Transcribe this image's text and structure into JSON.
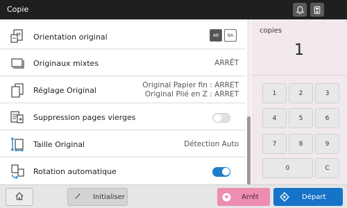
{
  "header": {
    "title": "Copie",
    "bell_icon": "bell-icon",
    "device_icon": "device-status-icon"
  },
  "settings": [
    {
      "label": "Orientation original",
      "icon": "orientation-icon",
      "options": [
        "AB",
        "BA"
      ],
      "selected": 0
    },
    {
      "label": "Originaux mixtes",
      "icon": "stacked-pages-icon",
      "value": "ARRÊT"
    },
    {
      "label": "Réglage Original",
      "icon": "pages-icon",
      "value_line1": "Original Papier fin : ARRET",
      "value_line2": "Original Plié en Z : ARRET"
    },
    {
      "label": "Suppression pages vierges",
      "icon": "skip-blank-pages-icon",
      "toggle": false
    },
    {
      "label": "Taille Original",
      "icon": "original-size-icon",
      "value": "Détection Auto"
    },
    {
      "label": "Rotation automatique",
      "icon": "auto-rotate-icon",
      "toggle": true
    }
  ],
  "keypad": {
    "label": "copies",
    "value": "1",
    "keys": [
      "1",
      "2",
      "3",
      "4",
      "5",
      "6",
      "7",
      "8",
      "9",
      "0",
      "C"
    ]
  },
  "footer": {
    "home_icon": "home-icon",
    "reset_label": "Initialiser",
    "stop_label": "Arrêt",
    "start_label": "Départ"
  },
  "colors": {
    "topbar": "#1f1f1f",
    "keypad_bg": "#f1e9ee",
    "stop": "#ec8db1",
    "start": "#1673c8",
    "toggle_on": "#1f7fc9"
  }
}
